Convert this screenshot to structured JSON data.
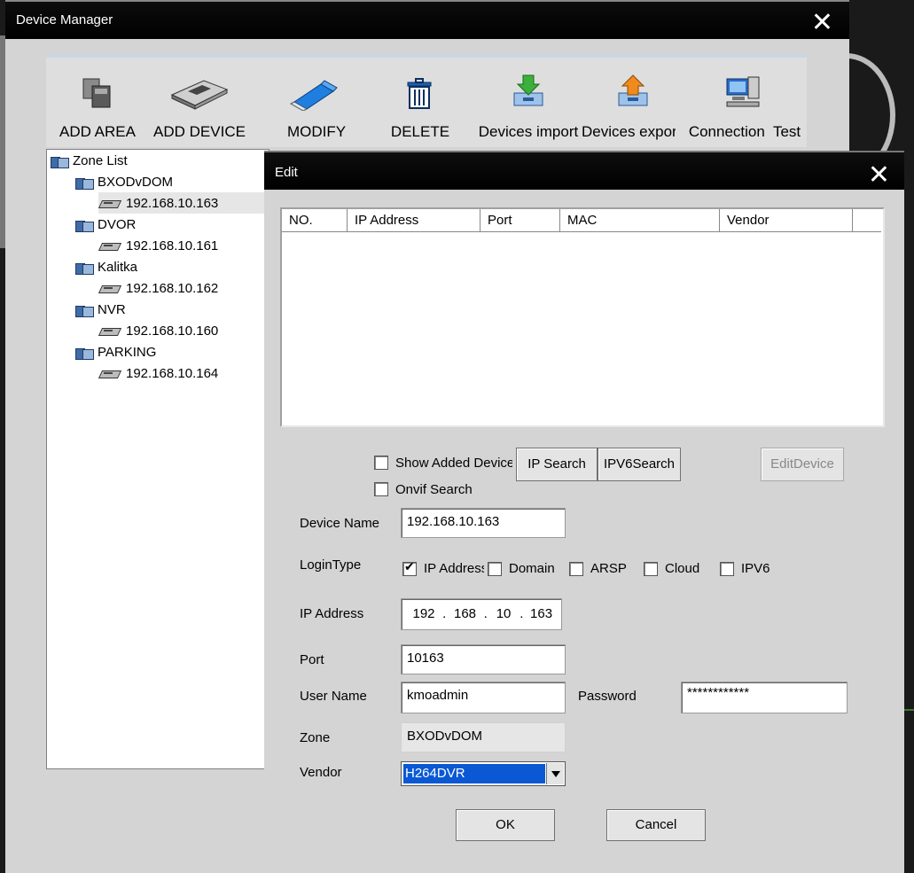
{
  "device_manager": {
    "title": "Device Manager",
    "toolbar": [
      {
        "label": "ADD AREA",
        "icon": "add-area-icon"
      },
      {
        "label": "ADD DEVICE",
        "icon": "add-device-icon"
      },
      {
        "label": "MODIFY",
        "icon": "modify-icon"
      },
      {
        "label": "DELETE",
        "icon": "trash-icon"
      },
      {
        "label": "Devices import",
        "icon": "import-icon"
      },
      {
        "label": "Devices export",
        "icon": "export-icon"
      },
      {
        "label": "Connection  Test",
        "icon": "connection-test-icon"
      }
    ],
    "tree": {
      "root": "Zone List",
      "zones": [
        {
          "name": "BXODvDOM",
          "devices": [
            "192.168.10.163"
          ]
        },
        {
          "name": "DVOR",
          "devices": [
            "192.168.10.161"
          ]
        },
        {
          "name": "Kalitka",
          "devices": [
            "192.168.10.162"
          ]
        },
        {
          "name": "NVR",
          "devices": [
            "192.168.10.160"
          ]
        },
        {
          "name": "PARKING",
          "devices": [
            "192.168.10.164"
          ]
        }
      ]
    }
  },
  "edit": {
    "title": "Edit",
    "grid_columns": [
      "NO.",
      "IP Address",
      "Port",
      "MAC",
      "Vendor"
    ],
    "show_added_label": "Show Added Device",
    "onvif_label": "Onvif Search",
    "ip_search_label": "IP Search",
    "ipv6_search_label": "IPV6Search",
    "edit_device_label": "EditDevice",
    "device_name_label": "Device Name",
    "device_name_value": "192.168.10.163",
    "login_type_label": "LoginType",
    "login_types": [
      {
        "label": "IP Address",
        "checked": true
      },
      {
        "label": "Domain",
        "checked": false
      },
      {
        "label": "ARSP",
        "checked": false
      },
      {
        "label": "Cloud",
        "checked": false
      },
      {
        "label": "IPV6",
        "checked": false
      }
    ],
    "ip_label": "IP Address",
    "ip_parts": [
      "192",
      "168",
      "10",
      "163"
    ],
    "port_label": "Port",
    "port_value": "10163",
    "user_label": "User Name",
    "user_value": "kmoadmin",
    "password_label": "Password",
    "password_value": "************",
    "zone_label": "Zone",
    "zone_value": "BXODvDOM",
    "vendor_label": "Vendor",
    "vendor_value": "H264DVR",
    "ok_label": "OK",
    "cancel_label": "Cancel"
  },
  "colors": {
    "titlebar": "#000000",
    "window_bg": "#d4d4d4",
    "selection": "#0a58d4"
  }
}
